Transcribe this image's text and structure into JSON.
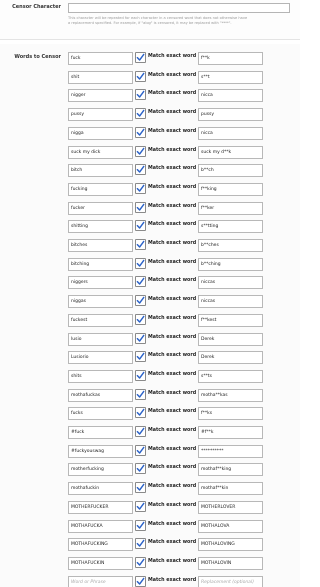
{
  "censor_character": {
    "label": "Censor Character",
    "value": "",
    "hint": "This character will be repeated for each character in a censored word that does not otherwise have a replacement specified. For example, if \"alog\" is censored, it may be replaced with \"****\"."
  },
  "words_to_censor": {
    "label": "Words to Censor",
    "match_label": "Match exact word",
    "rows": [
      {
        "word": "fuck",
        "checked": true,
        "replacement": "f**k"
      },
      {
        "word": "shit",
        "checked": true,
        "replacement": "s**t"
      },
      {
        "word": "nigger",
        "checked": true,
        "replacement": "nicca"
      },
      {
        "word": "pussy",
        "checked": true,
        "replacement": "pussy"
      },
      {
        "word": "nigga",
        "checked": true,
        "replacement": "nicca"
      },
      {
        "word": "suck my dick",
        "checked": true,
        "replacement": "suck my d**k"
      },
      {
        "word": "bitch",
        "checked": true,
        "replacement": "b**ch"
      },
      {
        "word": "fucking",
        "checked": true,
        "replacement": "f**king"
      },
      {
        "word": "fucker",
        "checked": true,
        "replacement": "f**ker"
      },
      {
        "word": "shitting",
        "checked": true,
        "replacement": "s**tting"
      },
      {
        "word": "bitches",
        "checked": true,
        "replacement": "b**ches"
      },
      {
        "word": "bitching",
        "checked": true,
        "replacement": "b**ching"
      },
      {
        "word": "niggers",
        "checked": true,
        "replacement": "niccas"
      },
      {
        "word": "niggas",
        "checked": true,
        "replacement": "niccas"
      },
      {
        "word": "fuckest",
        "checked": true,
        "replacement": "f**kest"
      },
      {
        "word": "lusio",
        "checked": true,
        "replacement": "Derek"
      },
      {
        "word": "Lusiorio",
        "checked": true,
        "replacement": "Derek"
      },
      {
        "word": "shits",
        "checked": true,
        "replacement": "s**ts"
      },
      {
        "word": "mothafuckas",
        "checked": true,
        "replacement": "motha**kas"
      },
      {
        "word": "fucks",
        "checked": true,
        "replacement": "f**ks"
      },
      {
        "word": "#fuck",
        "checked": true,
        "replacement": "#f**k"
      },
      {
        "word": "#fuckyouswag",
        "checked": true,
        "replacement": "**********"
      },
      {
        "word": "motherfucking",
        "checked": true,
        "replacement": "mothaf**king"
      },
      {
        "word": "mothafuckin",
        "checked": true,
        "replacement": "mothaf**kin"
      },
      {
        "word": "MOTHERFUCKER",
        "checked": true,
        "replacement": "MOTHERLOVER"
      },
      {
        "word": "MOTHAFUCKA",
        "checked": true,
        "replacement": "MOTHALOVA"
      },
      {
        "word": "MOTHAFUCKING",
        "checked": true,
        "replacement": "MOTHALOVING"
      },
      {
        "word": "MOTHAFUCKIN",
        "checked": true,
        "replacement": "MOTHALOVIN"
      }
    ],
    "new_row": {
      "word_placeholder": "Word or Phrase",
      "replacement_placeholder": "Replacement (optional)",
      "checked": true
    }
  }
}
